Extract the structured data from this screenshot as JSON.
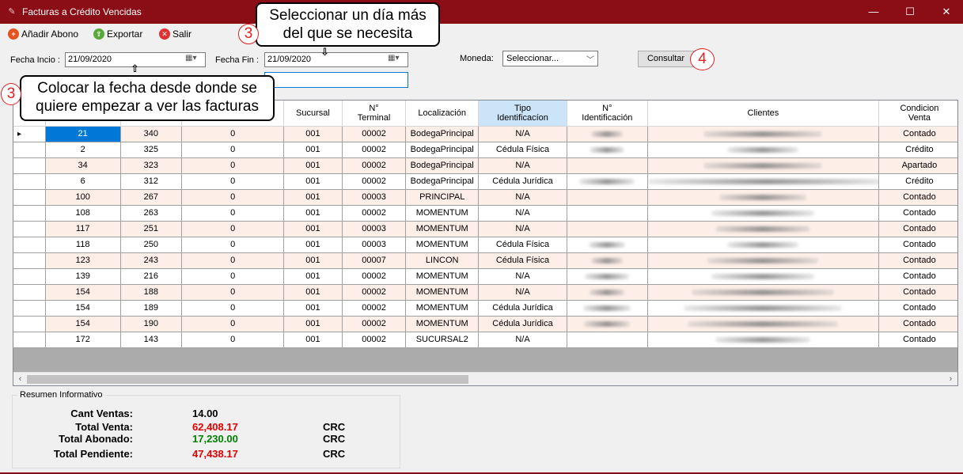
{
  "window": {
    "title": "Facturas a Crédito Vencidas"
  },
  "toolbar": {
    "add": "Añadir Abono",
    "export": "Exportar",
    "exit": "Salir"
  },
  "filters": {
    "start_label": "Fecha Incio :",
    "start_value": "21/09/2020",
    "end_label": "Fecha Fin :",
    "end_value": "21/09/2020",
    "currency_label": "Moneda:",
    "currency_value": "Seleccionar...",
    "query_button": "Consultar"
  },
  "annotations": {
    "end_date_tip_line1": "Seleccionar un día más",
    "end_date_tip_line2": "del que se necesita",
    "start_date_tip_line1": "Colocar la fecha desde donde se",
    "start_date_tip_line2": "quiere empezar a ver las facturas",
    "step_3": "3",
    "step_4": "4"
  },
  "grid": {
    "headers": [
      "",
      "",
      "",
      "Sucursal",
      "N°\nTerminal",
      "Localización",
      "Tipo\nIdentificacíon",
      "N°\nIdentificación",
      "Clientes",
      "Condicion\nVenta"
    ],
    "rows": [
      [
        "21",
        "340",
        "0",
        "001",
        "00002",
        "BodegaPrincipal",
        "N/A",
        "",
        "Contado"
      ],
      [
        "2",
        "325",
        "0",
        "001",
        "00002",
        "BodegaPrincipal",
        "Cédula Física",
        "",
        "Crédito"
      ],
      [
        "34",
        "323",
        "0",
        "001",
        "00002",
        "BodegaPrincipal",
        "N/A",
        "",
        "Apartado"
      ],
      [
        "6",
        "312",
        "0",
        "001",
        "00002",
        "BodegaPrincipal",
        "Cédula Jurídica",
        "",
        "Crédito"
      ],
      [
        "100",
        "267",
        "0",
        "001",
        "00003",
        "PRINCIPAL",
        "N/A",
        "",
        "Contado"
      ],
      [
        "108",
        "263",
        "0",
        "001",
        "00002",
        "MOMENTUM",
        "N/A",
        "",
        "Contado"
      ],
      [
        "117",
        "251",
        "0",
        "001",
        "00003",
        "MOMENTUM",
        "N/A",
        "",
        "Contado"
      ],
      [
        "118",
        "250",
        "0",
        "001",
        "00003",
        "MOMENTUM",
        "Cédula Física",
        "",
        "Contado"
      ],
      [
        "123",
        "243",
        "0",
        "001",
        "00007",
        "LINCON",
        "Cédula Física",
        "",
        "Contado"
      ],
      [
        "139",
        "216",
        "0",
        "001",
        "00002",
        "MOMENTUM",
        "N/A",
        "",
        "Contado"
      ],
      [
        "154",
        "188",
        "0",
        "001",
        "00002",
        "MOMENTUM",
        "N/A",
        "",
        "Contado"
      ],
      [
        "154",
        "189",
        "0",
        "001",
        "00002",
        "MOMENTUM",
        "Cédula Jurídica",
        "",
        "Contado"
      ],
      [
        "154",
        "190",
        "0",
        "001",
        "00002",
        "MOMENTUM",
        "Cédula Jurídica",
        "",
        "Contado"
      ],
      [
        "172",
        "143",
        "0",
        "001",
        "00002",
        "SUCURSAL2",
        "N/A",
        "",
        "Contado"
      ]
    ]
  },
  "summary": {
    "legend": "Resumen Informativo",
    "cant_label": "Cant Ventas:",
    "cant_value": "14.00",
    "total_venta_label": "Total Venta:",
    "total_venta_value": "62,408.17",
    "total_abonado_label": "Total Abonado:",
    "total_abonado_value": "17,230.00",
    "total_pendiente_label": "Total Pendiente:",
    "total_pendiente_value": "47,438.17",
    "currency": "CRC"
  },
  "colors": {
    "titlebar": "#8b0e16",
    "negative": "#e00000",
    "positive": "#008000",
    "selection": "#0078d7"
  }
}
